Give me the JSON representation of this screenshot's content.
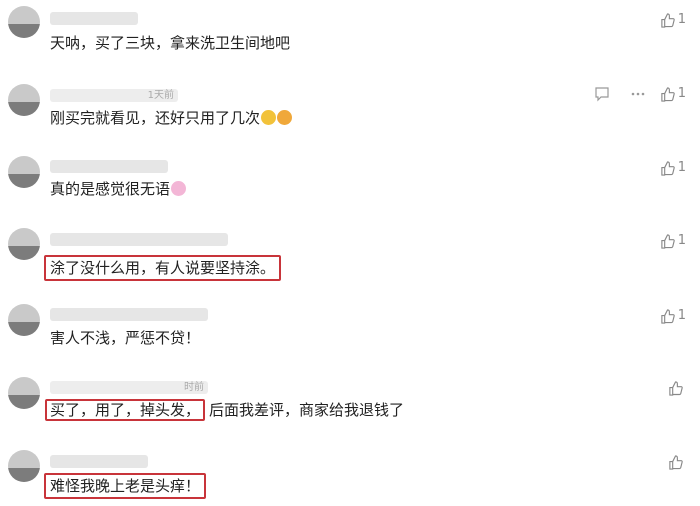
{
  "comments": [
    {
      "name": "",
      "time": "",
      "text": "天呐，买了三块，拿来洗卫生间地吧",
      "likes": "1",
      "emojis": []
    },
    {
      "name": "",
      "time": "1天前",
      "text": "刚买完就看见，还好只用了几次",
      "likes": "1",
      "emojis": [
        "laughing-emoji",
        "facepalm-emoji"
      ]
    },
    {
      "name": "",
      "time": "",
      "text": "真的是感觉很无语",
      "likes": "1",
      "emojis": [
        "pig-emoji"
      ]
    },
    {
      "name": "",
      "time": "",
      "text": "涂了没什么用，有人说要坚持涂。",
      "likes": "1",
      "emojis": []
    },
    {
      "name": "",
      "time": "",
      "text": "害人不浅，严惩不贷！",
      "likes": "1",
      "emojis": []
    },
    {
      "name": "",
      "time": "时前",
      "text_boxed": "买了，用了，掉头发，",
      "text_rest": "后面我差评，商家给我退钱了",
      "likes": "",
      "emojis": []
    },
    {
      "name": "",
      "time": "",
      "text": "难怪我晚上老是头痒！",
      "likes": "",
      "emojis": []
    }
  ],
  "highlight_color": "#c8343a"
}
